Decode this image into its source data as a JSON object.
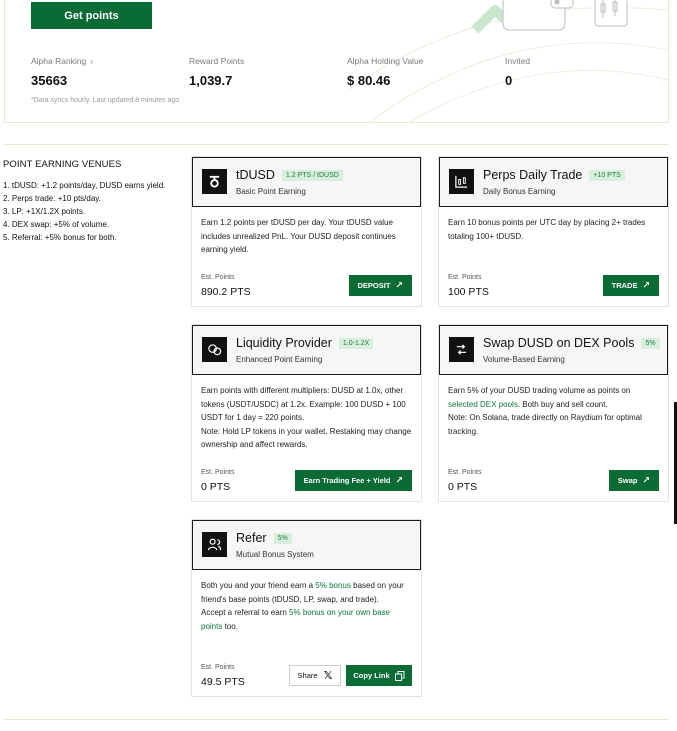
{
  "header": {
    "get_points_label": "Get points",
    "stats": [
      {
        "label": "Alpha Ranking",
        "value": "35663",
        "chevron": true
      },
      {
        "label": "Reward Points",
        "value": "1,039.7"
      },
      {
        "label": "Alpha Holding Value",
        "value": "$ 80.46"
      },
      {
        "label": "Invited",
        "value": "0"
      }
    ],
    "sync_note": "*Data syncs hourly. Last updated 8 minutes ago"
  },
  "earning": {
    "title": "POINT EARNING VENUES",
    "items": [
      "1. tDUSD: +1.2 points/day, DUSD earns yield.",
      "2. Perps trade: +10 pts/day.",
      "3. LP: +1X/1.2X points.",
      "4. DEX swap: +5% of volume.",
      "5. Referral: +5% bonus for both."
    ]
  },
  "cards": {
    "tdusd": {
      "icon": "tdusd-icon",
      "title": "tDUSD",
      "badge": "1.2 PTS / tDUSD",
      "subtitle": "Basic Point Earning",
      "body": "Earn 1.2 points per tDUSD per day. Your tDUSD value includes unrealized PnL. Your DUSD deposit continues earning yield.",
      "est_label": "Est. Points",
      "est_value": "890.2 PTS",
      "action": "DEPOSIT"
    },
    "perps": {
      "icon": "chart-icon",
      "title": "Perps Daily Trade",
      "badge": "+10 PTS",
      "subtitle": "Daily Bonus Earning",
      "body": "Earn 10 bonus points per UTC day by placing 2+ trades totaling 100+ tDUSD.",
      "est_label": "Est. Points",
      "est_value": "100 PTS",
      "action": "TRADE"
    },
    "liquidity": {
      "icon": "coins-icon",
      "title": "Liquidity Provider",
      "badge": "1.0-1.2X",
      "subtitle": "Enhanced Point Earning",
      "body1": "Earn points with different multipliers: DUSD at 1.0x, other tokens (USDT/USDC) at 1.2x. Example: 100 DUSD + 100 USDT for 1 day = 220 points.",
      "body2": "Note: Hold LP tokens in your wallet. Restaking may change ownership and affect rewards.",
      "est_label": "Est. Points",
      "est_value": "0 PTS",
      "action": "Earn Trading Fee + Yield"
    },
    "swap": {
      "icon": "swap-icon",
      "title": "Swap DUSD on DEX Pools",
      "badge": "5%",
      "subtitle": "Volume-Based Earning",
      "body_pre": "Earn 5% of your DUSD trading volume as points on ",
      "body_link": "selected DEX pools",
      "body_post": ". Both buy and sell count.",
      "body2": "Note: On Solana, trade directly on Raydium for optimal tracking.",
      "est_label": "Est. Points",
      "est_value": "0 PTS",
      "action": "Swap"
    },
    "refer": {
      "icon": "users-icon",
      "title": "Refer",
      "badge": "5%",
      "subtitle": "Mutual Bonus System",
      "body_pre": "Both you and your friend earn a ",
      "body_link": "5% bonus",
      "body_post": " based on your friend's base points (tDUSD, LP, swap, and trade).",
      "body2_pre": "Accept a referral to earn ",
      "body2_link": "5% bonus on your own base points",
      "body2_post": " too.",
      "est_label": "Est. Points",
      "est_value": "49.5 PTS",
      "share_label": "Share",
      "copy_label": "Copy Link"
    }
  },
  "colors": {
    "brand_green": "#0a6b34",
    "badge_bg": "#d9efde",
    "link_green": "#0a7a3a"
  }
}
